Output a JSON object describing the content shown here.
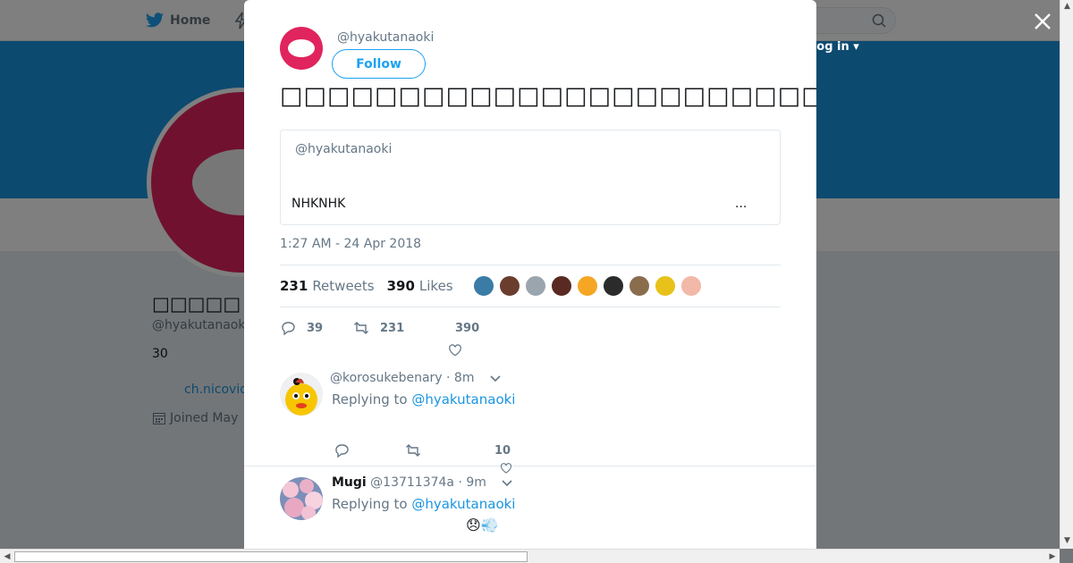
{
  "nav": {
    "home_label": "Home",
    "login_label": "Log in ▾"
  },
  "profile": {
    "name": "□□□□□",
    "handle": "@hyakutanaoki",
    "bio": "30",
    "link": "ch.nicovid",
    "joined": "Joined May"
  },
  "tweet": {
    "handle": "@hyakutanaoki",
    "follow_label": "Follow",
    "text": "□□□□□□□□□□□□□□□□□□□□□□□□□□□□□□□□□□□□□□□□□□□□□□□□□□□□□□□□□□□□",
    "quote": {
      "handle": "@hyakutanaoki",
      "text": "NHKNHK",
      "more": "..."
    },
    "timestamp": "1:27 AM - 24 Apr 2018",
    "retweets_count": "231",
    "retweets_label": "Retweets",
    "likes_count": "390",
    "likes_label": "Likes",
    "likers_colors": [
      "#3a7ca5",
      "#6b3d2e",
      "#9aa5ae",
      "#5a2a22",
      "#f5a623",
      "#2b2b2b",
      "#8a6d4d",
      "#e8c21a",
      "#f2b8a8"
    ],
    "actions": {
      "replies": "39",
      "retweets": "231",
      "likes": "390"
    }
  },
  "replies": [
    {
      "name": "",
      "handle": "@korosukebenary",
      "time": "· 8m",
      "replying_prefix": "Replying to",
      "replying_to": "@hyakutanaoki",
      "text": "",
      "likes": "10",
      "avatar_color": "#f7c600"
    },
    {
      "name": "Mugi",
      "handle": "@13711374a",
      "time": "· 9m",
      "replying_prefix": "Replying to",
      "replying_to": "@hyakutanaoki",
      "text": "😞💨",
      "likes": "",
      "avatar_color": "#c9a0c8"
    }
  ],
  "colors": {
    "brand_blue": "#1da1f2",
    "banner": "#1b95e0",
    "avatar_red": "#e0245e"
  }
}
